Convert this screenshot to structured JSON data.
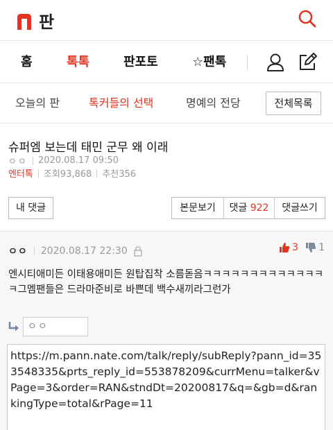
{
  "brand": {
    "logo_text": "판",
    "accent_color": "#e33322"
  },
  "main_nav": {
    "tabs": [
      {
        "label": "홈",
        "active": false
      },
      {
        "label": "톡톡",
        "active": true
      },
      {
        "label": "판포토",
        "active": false
      },
      {
        "label": "☆팬톡",
        "active": false
      }
    ]
  },
  "sub_nav": {
    "items": [
      {
        "label": "오늘의 판",
        "active": false
      },
      {
        "label": "톡커들의 선택",
        "active": true
      },
      {
        "label": "명예의 전당",
        "active": false
      }
    ],
    "all_button": "전체목록"
  },
  "post": {
    "title": "슈퍼엠 보는데 태민 군무 왜 이래",
    "author": "ㅇㅇ",
    "date": "2020.08.17 09:50",
    "category": "엔터톡",
    "views": "조회93,868",
    "recommends": "추천356"
  },
  "actions": {
    "my_comments": "내 댓글",
    "view_post": "본문보기",
    "comments_label": "댓글",
    "comments_count": "922",
    "write_comment": "댓글쓰기"
  },
  "comment": {
    "author": "ㅇㅇ",
    "date": "2020.08.17 22:30",
    "likes": "3",
    "dislikes": "1",
    "body": "엔시티애미든 이태용애미든 원탑집착 소름돋음ㅋㅋㅋㅋㅋㅋㅋㅋㅋㅋㅋㅋㅋㅋ그멤팬들은 드라마준비로 바쁜데 백수새끼라그런가"
  },
  "reply": {
    "name_value": "ㅇㅇ",
    "text_value": "https://m.pann.nate.com/talk/reply/subReply?pann_id=353548335&prts_reply_id=553878209&currMenu=talker&vPage=3&order=RAN&stndDt=20200817&q=&gb=d&rankingType=total&rPage=11"
  }
}
